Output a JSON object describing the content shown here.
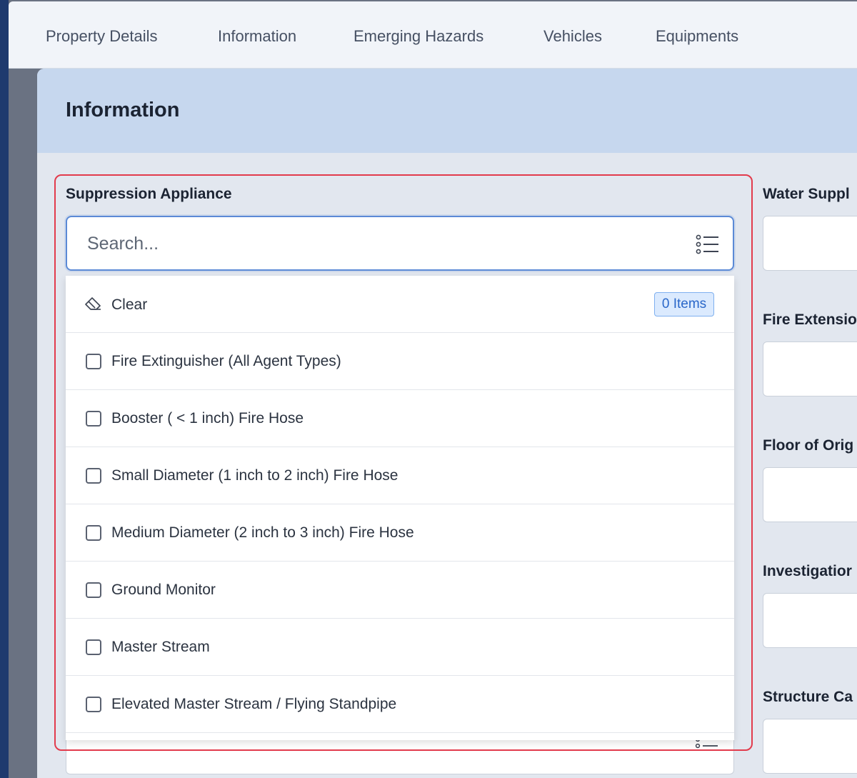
{
  "nav": {
    "tabs": [
      {
        "label": "Property Details"
      },
      {
        "label": "Information"
      },
      {
        "label": "Emerging Hazards"
      },
      {
        "label": "Vehicles"
      },
      {
        "label": "Equipments"
      }
    ]
  },
  "page": {
    "title": "Information"
  },
  "suppression": {
    "label": "Suppression Appliance",
    "search_placeholder": "Search...",
    "list_icon": "list-icon",
    "dropdown": {
      "clear_label": "Clear",
      "clear_icon": "eraser-icon",
      "count_badge": "0 Items",
      "options": [
        {
          "label": "Fire Extinguisher (All Agent Types)",
          "checked": false
        },
        {
          "label": "Booster ( < 1 inch) Fire Hose",
          "checked": false
        },
        {
          "label": "Small Diameter (1 inch to 2 inch) Fire Hose",
          "checked": false
        },
        {
          "label": "Medium Diameter (2 inch to 3 inch) Fire Hose",
          "checked": false
        },
        {
          "label": "Ground Monitor",
          "checked": false
        },
        {
          "label": "Master Stream",
          "checked": false
        },
        {
          "label": "Elevated Master Stream / Flying Standpipe",
          "checked": false
        }
      ]
    }
  },
  "right_column": {
    "fields": [
      {
        "label": "Water Suppl"
      },
      {
        "label": "Fire Extensio"
      },
      {
        "label": "Floor of Orig"
      },
      {
        "label": "Investigatior"
      },
      {
        "label": "Structure Ca"
      }
    ]
  },
  "colors": {
    "accent_blue": "#5b8ad6",
    "highlight_red": "#e23b4c",
    "header_band": "#c6d7ee",
    "badge_bg": "#dbeafe",
    "badge_text": "#2a67c9"
  }
}
